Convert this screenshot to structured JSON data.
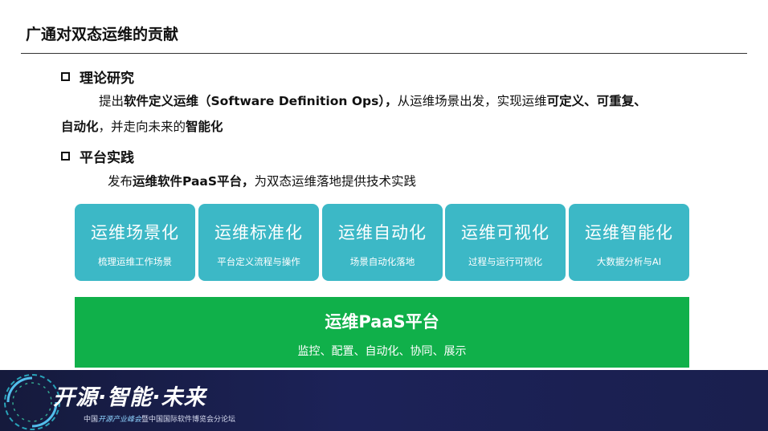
{
  "title": "广通对双态运维的贡献",
  "section1": {
    "heading": "理论研究",
    "line1": {
      "p1": "提出",
      "b1": "软件定义运维（Software Definition Ops），",
      "p2": "从运维场景出发，实现运维",
      "b2": "可定义、可重复、"
    },
    "line2": {
      "b1": "自动化",
      "p1": "，并走向未来的",
      "b2": "智能化"
    }
  },
  "section2": {
    "heading": "平台实践",
    "line": {
      "p1": "发布",
      "b1": "运维软件PaaS平台，",
      "p2": "为双态运维落地提供技术实践"
    }
  },
  "cards": [
    {
      "title": "运维场景化",
      "subtitle": "梳理运维工作场景"
    },
    {
      "title": "运维标准化",
      "subtitle": "平台定义流程与操作"
    },
    {
      "title": "运维自动化",
      "subtitle": "场景自动化落地"
    },
    {
      "title": "运维可视化",
      "subtitle": "过程与运行可视化"
    },
    {
      "title": "运维智能化",
      "subtitle": "大数据分析与AI"
    }
  ],
  "platform": {
    "title": "运维PaaS平台",
    "subtitle": "监控、配置、自动化、协同、展示"
  },
  "footer": {
    "slogan": "开源·智能·未来",
    "sub_prefix": "中国",
    "sub_accent": "开源产业峰会",
    "sub_suffix": "暨中国国际软件博览会分论坛"
  },
  "colors": {
    "card": "#3cb8c6",
    "platform": "#10b04a",
    "footer": "#1c2258"
  }
}
